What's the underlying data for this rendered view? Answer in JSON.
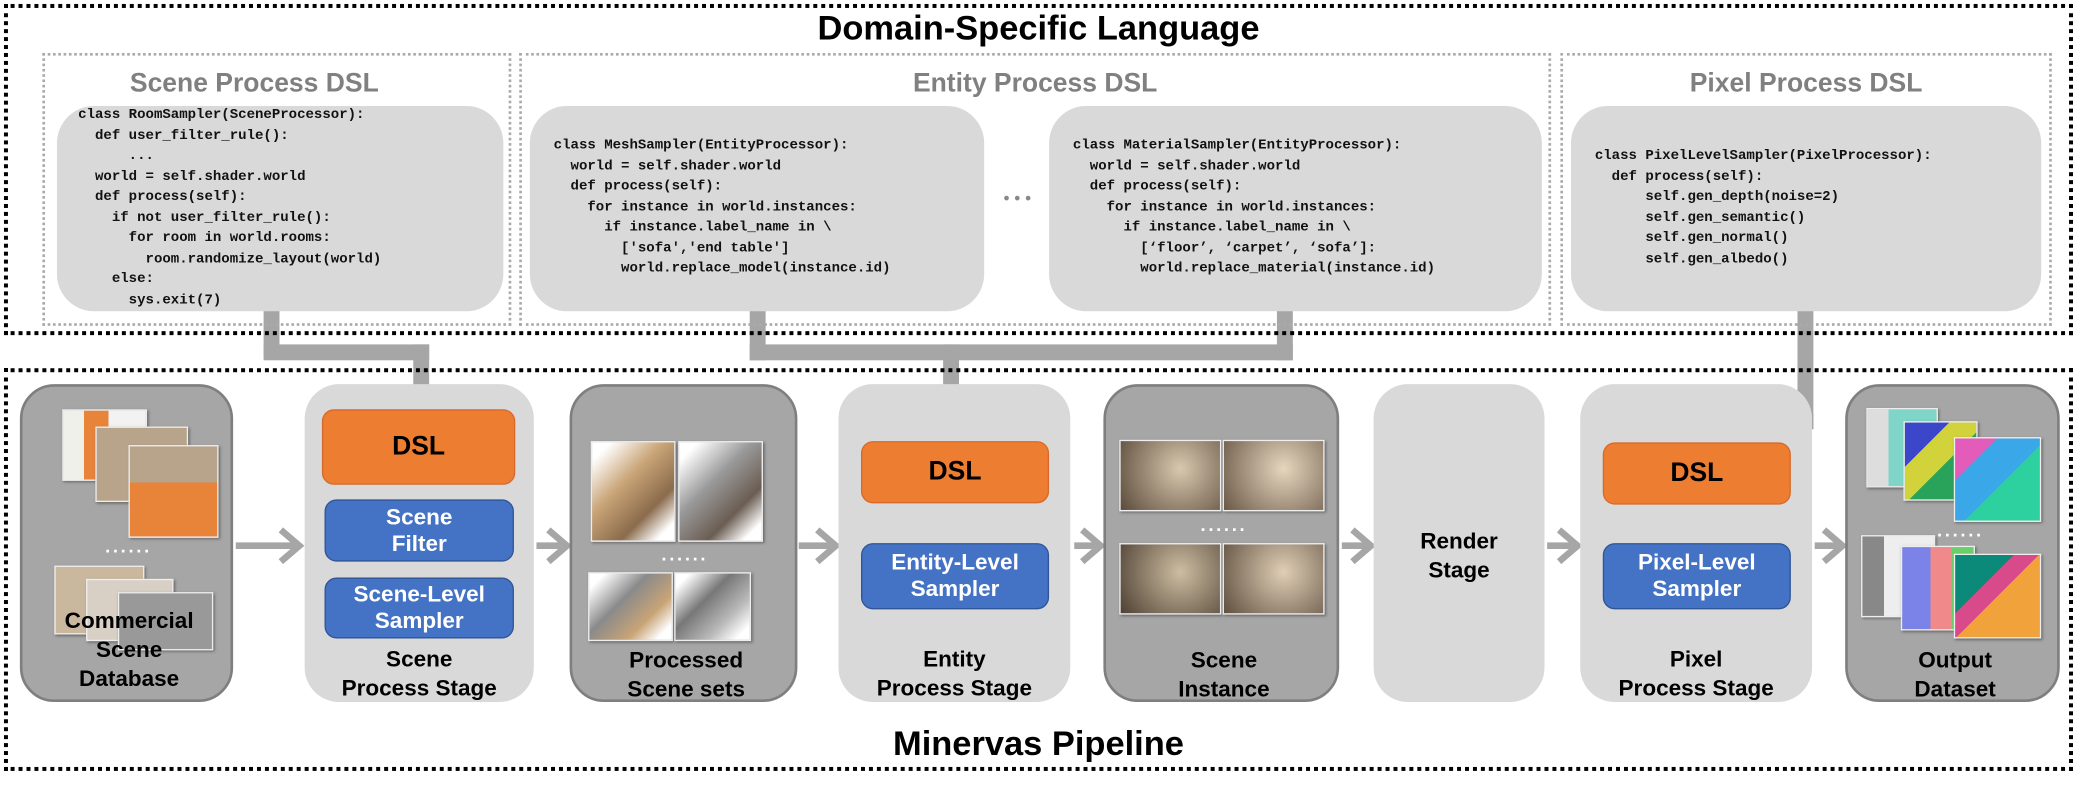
{
  "dsl_section": {
    "title": "Domain-Specific Language",
    "scene": {
      "title": "Scene Process DSL",
      "code": "class RoomSampler(SceneProcessor):\n  def user_filter_rule():\n      ...\n  world = self.shader.world\n  def process(self):\n    if not user_filter_rule():\n      for room in world.rooms:\n        room.randomize_layout(world)\n    else:\n      sys.exit(7)"
    },
    "entity": {
      "title": "Entity Process DSL",
      "code_mesh": "class MeshSampler(EntityProcessor):\n  world = self.shader.world\n  def process(self):\n    for instance in world.instances:\n      if instance.label_name in \\\n        ['sofa','end table']\n        world.replace_model(instance.id)",
      "ellipsis": "• • •",
      "code_material": "class MaterialSampler(EntityProcessor):\n  world = self.shader.world\n  def process(self):\n    for instance in world.instances:\n      if instance.label_name in \\\n        [‘floor’, ‘carpet’, ‘sofa’]:\n        world.replace_material(instance.id)"
    },
    "pixel": {
      "title": "Pixel Process DSL",
      "code": "class PixelLevelSampler(PixelProcessor):\n  def process(self):\n      self.gen_depth(noise=2)\n      self.gen_semantic()\n      self.gen_normal()\n      self.gen_albedo()"
    }
  },
  "pipeline": {
    "title": "Minervas Pipeline",
    "more": "......",
    "stages": [
      {
        "label": "Commercial\nScene\nDatabase"
      },
      {
        "label": "Scene\nProcess Stage",
        "dsl": "DSL",
        "modules": [
          "Scene\nFilter",
          "Scene-Level\nSampler"
        ]
      },
      {
        "label": "Processed\nScene sets"
      },
      {
        "label": "Entity\nProcess Stage",
        "dsl": "DSL",
        "modules": [
          "Entity-Level\nSampler"
        ]
      },
      {
        "label": "Scene\nInstance"
      },
      {
        "label": "Render\nStage"
      },
      {
        "label": "Pixel\nProcess Stage",
        "dsl": "DSL",
        "modules": [
          "Pixel-Level\nSampler"
        ]
      },
      {
        "label": "Output\nDataset"
      }
    ]
  },
  "colors": {
    "dsl": "#ed7d31",
    "module": "#4472c4",
    "card_dark": "#a6a6a6",
    "card_light": "#d9d9d9",
    "connector": "#a6a6a6"
  }
}
